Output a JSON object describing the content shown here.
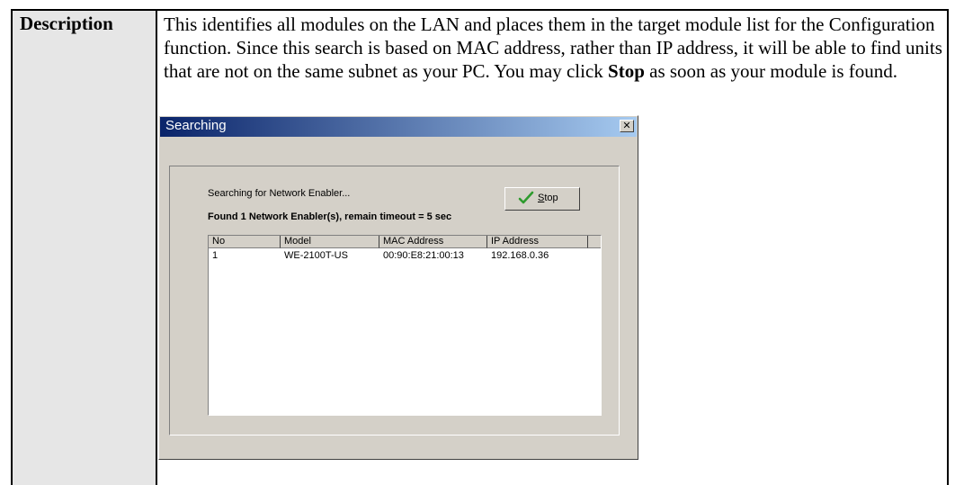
{
  "doc": {
    "label": "Description",
    "para_1": "This identifies all modules on the LAN and places them in the target module list for the Configuration function. Since this search is based on MAC address, rather than IP address, it will be able to find units that are not on the same subnet as your PC. You may click ",
    "para_bold": "Stop",
    "para_2": " as soon as your module is found."
  },
  "dialog": {
    "title": "Searching",
    "close_glyph": "✕",
    "status_text": "Searching for Network Enabler...",
    "found_text": "Found 1 Network Enabler(s), remain timeout = 5 sec",
    "stop_hotkey": "S",
    "stop_rest": "top",
    "columns": [
      "No",
      "Model",
      "MAC Address",
      "IP Address"
    ],
    "rows": [
      [
        "1",
        "WE-2100T-US",
        "00:90:E8:21:00:13",
        "192.168.0.36"
      ]
    ]
  },
  "icons": {
    "stop_button_icon": "checkmark-icon",
    "close_icon": "close-icon"
  },
  "colors": {
    "titlebar_start": "#0a246a",
    "titlebar_end": "#a6caf0",
    "dialog_face": "#d4d0c8",
    "label_cell_bg": "#e6e6e6",
    "check_green": "#2e9b2e"
  }
}
